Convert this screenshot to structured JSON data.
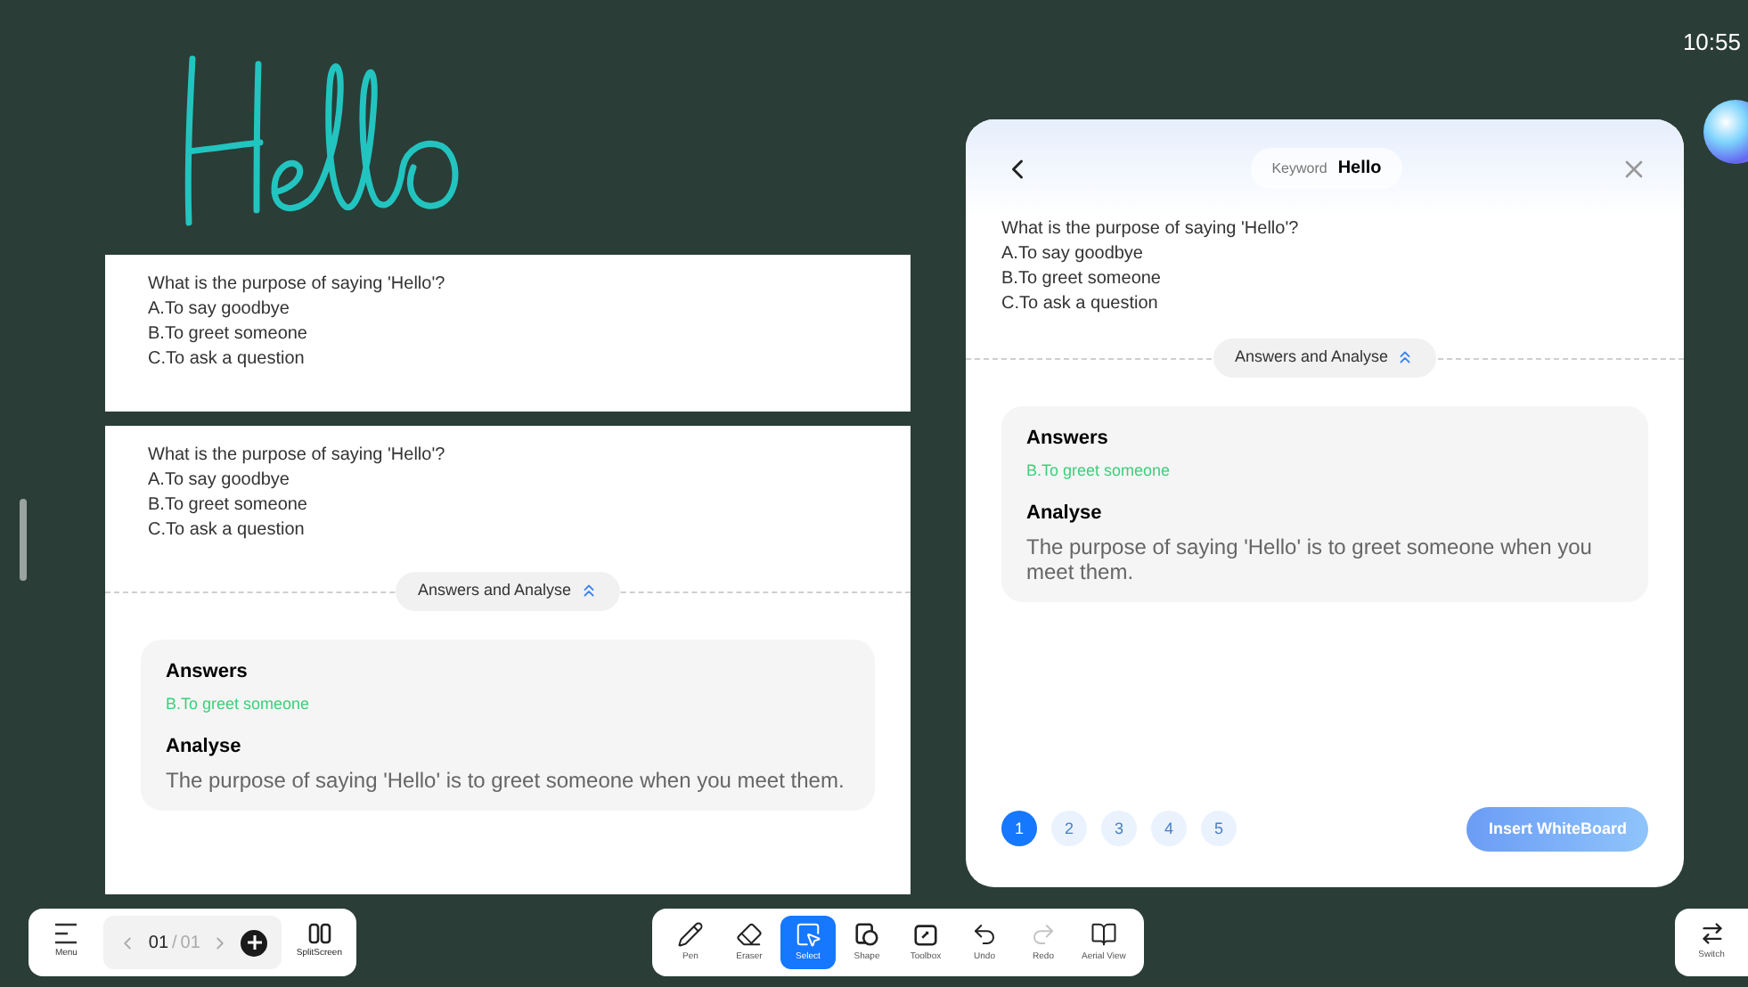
{
  "clock": "10:55",
  "canvas_cards": [
    {
      "question": "What is the purpose of saying 'Hello'?",
      "options": [
        "A.To say goodbye",
        "B.To greet someone",
        "C.To ask a question"
      ]
    },
    {
      "question": "What is the purpose of saying 'Hello'?",
      "options": [
        "A.To say goodbye",
        "B.To greet someone",
        "C.To ask a question"
      ],
      "toggle_label": "Answers and Analyse",
      "expanded": true,
      "answers_heading": "Answers",
      "answer": "B.To greet someone",
      "analyse_heading": "Analyse",
      "analysis": "The purpose of saying 'Hello' is to greet someone when you meet them."
    }
  ],
  "keyword_panel": {
    "keyword_label": "Keyword",
    "keyword": "Hello",
    "question": "What is the purpose of saying 'Hello'?",
    "options": [
      "A.To say goodbye",
      "B.To greet someone",
      "C.To ask a question"
    ],
    "toggle_label": "Answers and Analyse",
    "expanded": true,
    "answers_heading": "Answers",
    "answer": "B.To greet someone",
    "analyse_heading": "Analyse",
    "analysis": "The purpose of saying 'Hello' is to greet someone when you meet them.",
    "pages": [
      {
        "label": "1",
        "selected": true
      },
      {
        "label": "2",
        "selected": false
      },
      {
        "label": "3",
        "selected": false
      },
      {
        "label": "4",
        "selected": false
      },
      {
        "label": "5",
        "selected": false
      }
    ],
    "insert_button": "Insert WhiteBoard"
  },
  "left_toolbar": {
    "menu_label": "Menu",
    "page_current": "01",
    "page_separator": "/",
    "page_total": "01",
    "split_label": "SplitScreen"
  },
  "tools": [
    {
      "kind": "pen",
      "label": "Pen",
      "selected": false,
      "disabled": false
    },
    {
      "kind": "eraser",
      "label": "Eraser",
      "selected": false,
      "disabled": false
    },
    {
      "kind": "select",
      "label": "Select",
      "selected": true,
      "disabled": false
    },
    {
      "kind": "shape",
      "label": "Shape",
      "selected": false,
      "disabled": false
    },
    {
      "kind": "toolbox",
      "label": "Toolbox",
      "selected": false,
      "disabled": false
    },
    {
      "kind": "undo",
      "label": "Undo",
      "selected": false,
      "disabled": false
    },
    {
      "kind": "redo",
      "label": "Redo",
      "selected": false,
      "disabled": true
    },
    {
      "kind": "aerial",
      "label": "Aerial View",
      "selected": false,
      "disabled": false
    }
  ],
  "switch_label": "Switch"
}
